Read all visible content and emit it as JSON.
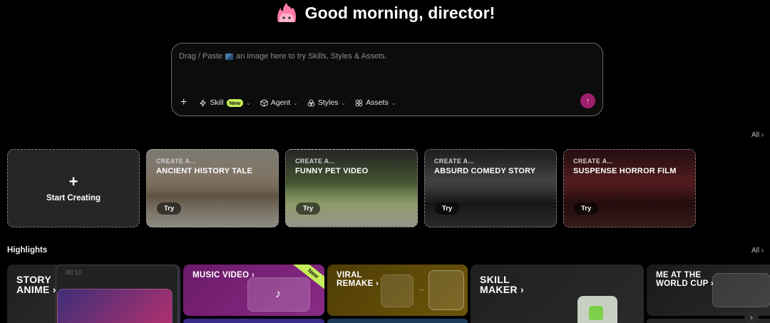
{
  "greeting": {
    "text": "Good morning, director!"
  },
  "prompt": {
    "placeholder_start": "Drag / Paste",
    "placeholder_end": "an image here to try Skills, Styles & Assets.",
    "toolbar": {
      "add": "+",
      "skill": "Skill",
      "skill_badge": "New",
      "agent": "Agent",
      "styles": "Styles",
      "assets": "Assets"
    },
    "send_icon": "arrow-up-icon"
  },
  "templates": {
    "all_label": "All",
    "start_label": "Start Creating",
    "items": [
      {
        "eyebrow": "CREATE A...",
        "title": "ANCIENT HISTORY TALE",
        "try": "Try"
      },
      {
        "eyebrow": "CREATE A...",
        "title": "FUNNY PET VIDEO",
        "try": "Try"
      },
      {
        "eyebrow": "CREATE A...",
        "title": "ABSURD COMEDY STORY",
        "try": "Try"
      },
      {
        "eyebrow": "CREATE A...",
        "title": "SUSPENSE HORROR FILM",
        "try": "Try"
      }
    ]
  },
  "highlights": {
    "title": "Highlights",
    "all_label": "All",
    "items": [
      {
        "line1": "STORY",
        "line2": "ANIME"
      },
      {
        "line1": "MUSIC VIDEO",
        "badge": "New"
      },
      {
        "line1": "VIRAL",
        "line2": "REMAKE"
      },
      {
        "line1": "SKILL",
        "line2": "MAKER"
      },
      {
        "line1": "ME AT THE",
        "line2": "WORLD CUP"
      }
    ],
    "timecode": "00:10"
  },
  "colors": {
    "accent_send": "#9c1f6c",
    "badge": "#c7ee5b",
    "background": "#000000"
  }
}
